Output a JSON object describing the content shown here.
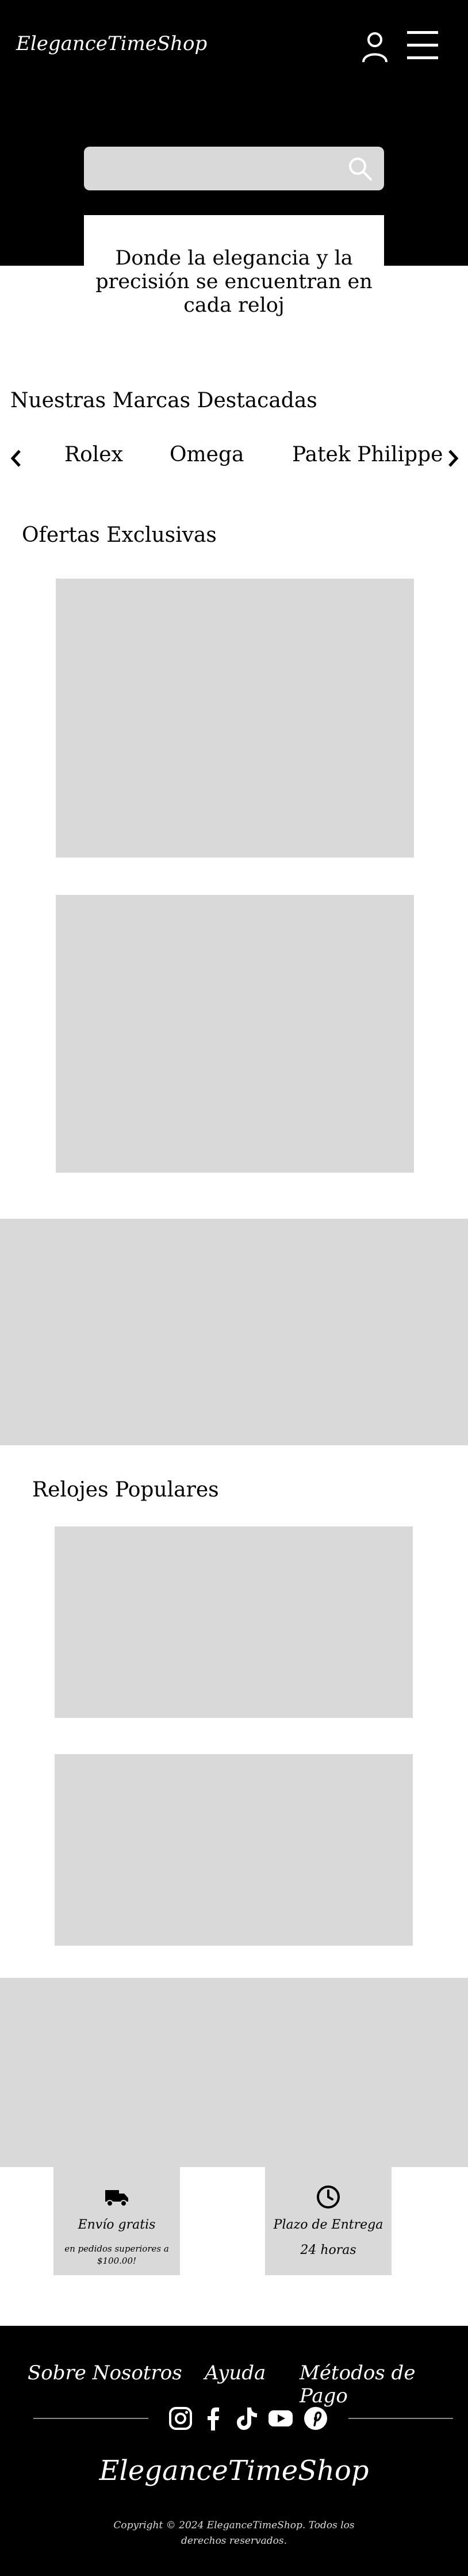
{
  "header": {
    "brand": "EleganceTimeShop"
  },
  "search": {
    "placeholder": ""
  },
  "hero": {
    "tagline": "Donde la elegancia y la precisión se encuentran en cada reloj"
  },
  "brands": {
    "title": "Nuestras Marcas Destacadas",
    "items": [
      "Rolex",
      "Omega",
      "Patek Philippe"
    ]
  },
  "offers": {
    "title": "Ofertas Exclusivas"
  },
  "popular": {
    "title": "Relojes Populares"
  },
  "features": [
    {
      "title": "Envío gratis",
      "subtitle": "en pedidos superiores a $100.00!",
      "icon": "truck-icon"
    },
    {
      "title": "Plazo de Entrega",
      "subtitle": "24 horas",
      "icon": "clock-icon"
    }
  ],
  "footer": {
    "links": [
      "Sobre Nosotros",
      "Ayuda",
      "Métodos de Pago"
    ],
    "social": [
      "instagram-icon",
      "facebook-icon",
      "tiktok-icon",
      "youtube-icon",
      "pinterest-icon"
    ],
    "brand": "EleganceTimeShop",
    "copyright": "Copyright © 2024 EleganceTimeShop. Todos los derechos reservados."
  },
  "colors": {
    "header_bg": "#000000",
    "placeholder": "#d9d9d9",
    "text": "#000000"
  }
}
